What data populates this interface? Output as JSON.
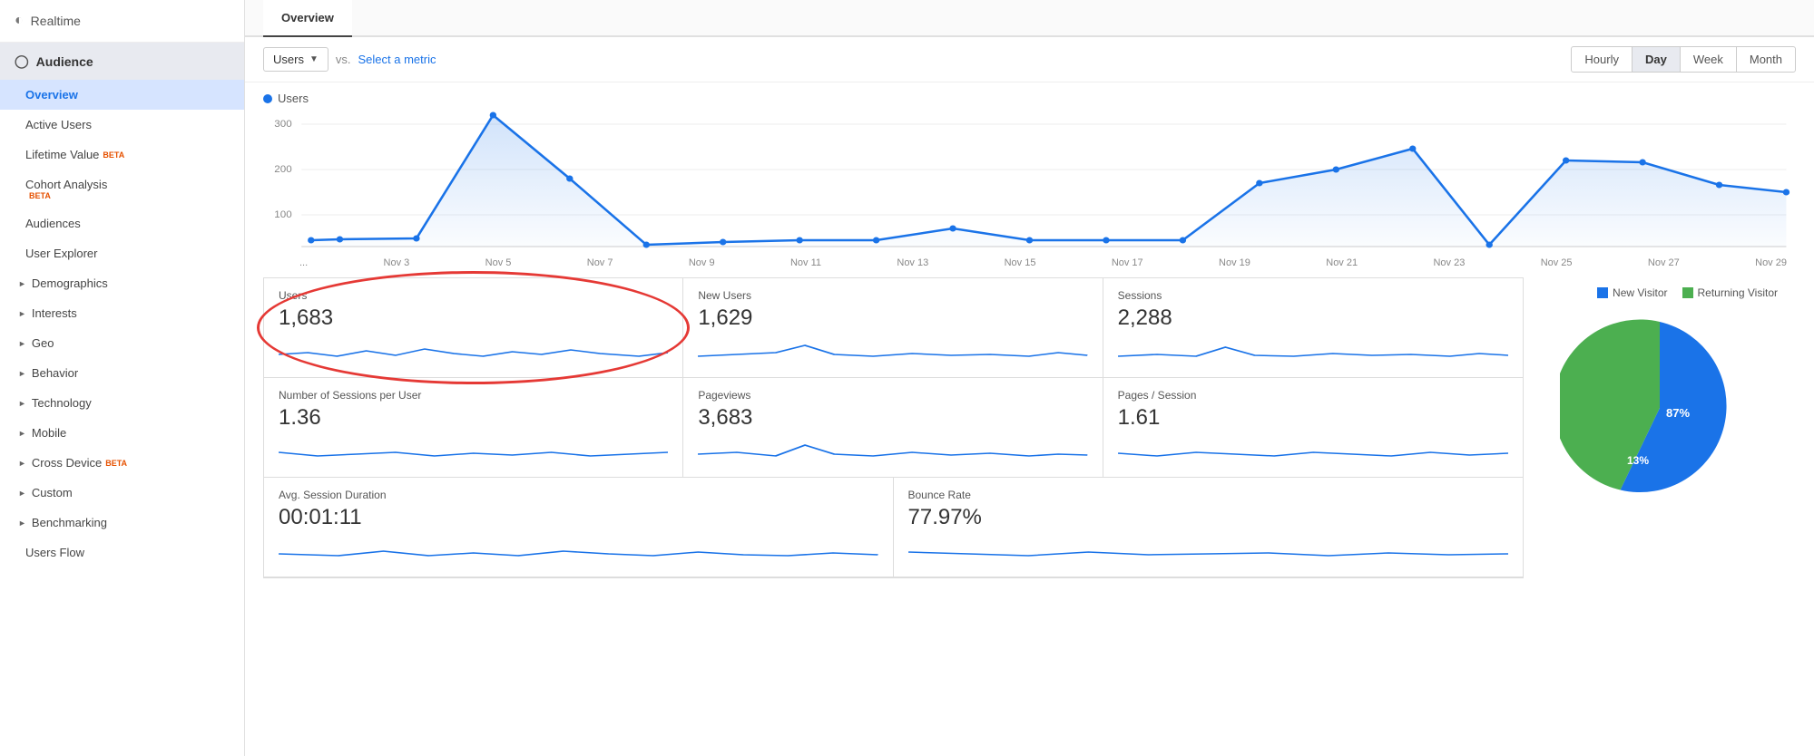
{
  "sidebar": {
    "realtime_label": "Realtime",
    "audience_label": "Audience",
    "items": [
      {
        "label": "Overview",
        "active": true,
        "sub": false,
        "beta": false
      },
      {
        "label": "Active Users",
        "active": false,
        "sub": false,
        "beta": false
      },
      {
        "label": "Lifetime Value",
        "active": false,
        "sub": false,
        "beta": true
      },
      {
        "label": "Cohort Analysis",
        "active": false,
        "sub": false,
        "beta": true,
        "beta_newline": true
      },
      {
        "label": "Audiences",
        "active": false,
        "sub": false,
        "beta": false
      },
      {
        "label": "User Explorer",
        "active": false,
        "sub": false,
        "beta": false
      },
      {
        "label": "Demographics",
        "active": false,
        "expandable": true,
        "beta": false
      },
      {
        "label": "Interests",
        "active": false,
        "expandable": true,
        "beta": false
      },
      {
        "label": "Geo",
        "active": false,
        "expandable": true,
        "beta": false
      },
      {
        "label": "Behavior",
        "active": false,
        "expandable": true,
        "beta": false
      },
      {
        "label": "Technology",
        "active": false,
        "expandable": true,
        "beta": false
      },
      {
        "label": "Mobile",
        "active": false,
        "expandable": true,
        "beta": false
      },
      {
        "label": "Cross Device",
        "active": false,
        "expandable": true,
        "beta": true
      },
      {
        "label": "Custom",
        "active": false,
        "expandable": true,
        "beta": false
      },
      {
        "label": "Benchmarking",
        "active": false,
        "expandable": true,
        "beta": false
      },
      {
        "label": "Users Flow",
        "active": false,
        "sub": false,
        "beta": false
      }
    ]
  },
  "tabs": [
    {
      "label": "Overview",
      "active": true
    }
  ],
  "toolbar": {
    "metric_label": "Users",
    "vs_text": "vs.",
    "select_metric": "Select a metric",
    "time_buttons": [
      "Hourly",
      "Day",
      "Week",
      "Month"
    ],
    "active_time": "Day"
  },
  "chart": {
    "legend_label": "Users",
    "y_labels": [
      "300",
      "200",
      "100"
    ],
    "x_labels": [
      "...",
      "Nov 3",
      "Nov 5",
      "Nov 7",
      "Nov 9",
      "Nov 11",
      "Nov 13",
      "Nov 15",
      "Nov 17",
      "Nov 19",
      "Nov 21",
      "Nov 23",
      "Nov 25",
      "Nov 27",
      "Nov 29"
    ]
  },
  "metrics": [
    {
      "title": "Users",
      "value": "1,683",
      "highlighted": true
    },
    {
      "title": "New Users",
      "value": "1,629",
      "highlighted": false
    },
    {
      "title": "Sessions",
      "value": "2,288",
      "highlighted": false
    },
    {
      "title": "Number of Sessions per User",
      "value": "1.36",
      "highlighted": false
    },
    {
      "title": "Pageviews",
      "value": "3,683",
      "highlighted": false
    },
    {
      "title": "Pages / Session",
      "value": "1.61",
      "highlighted": false
    },
    {
      "title": "Avg. Session Duration",
      "value": "00:01:11",
      "highlighted": false
    },
    {
      "title": "Bounce Rate",
      "value": "77.97%",
      "highlighted": false
    }
  ],
  "pie": {
    "new_visitor_label": "New Visitor",
    "returning_visitor_label": "Returning Visitor",
    "new_visitor_pct": "87%",
    "returning_visitor_pct": "13%",
    "new_visitor_color": "#1a73e8",
    "returning_visitor_color": "#4caf50"
  }
}
